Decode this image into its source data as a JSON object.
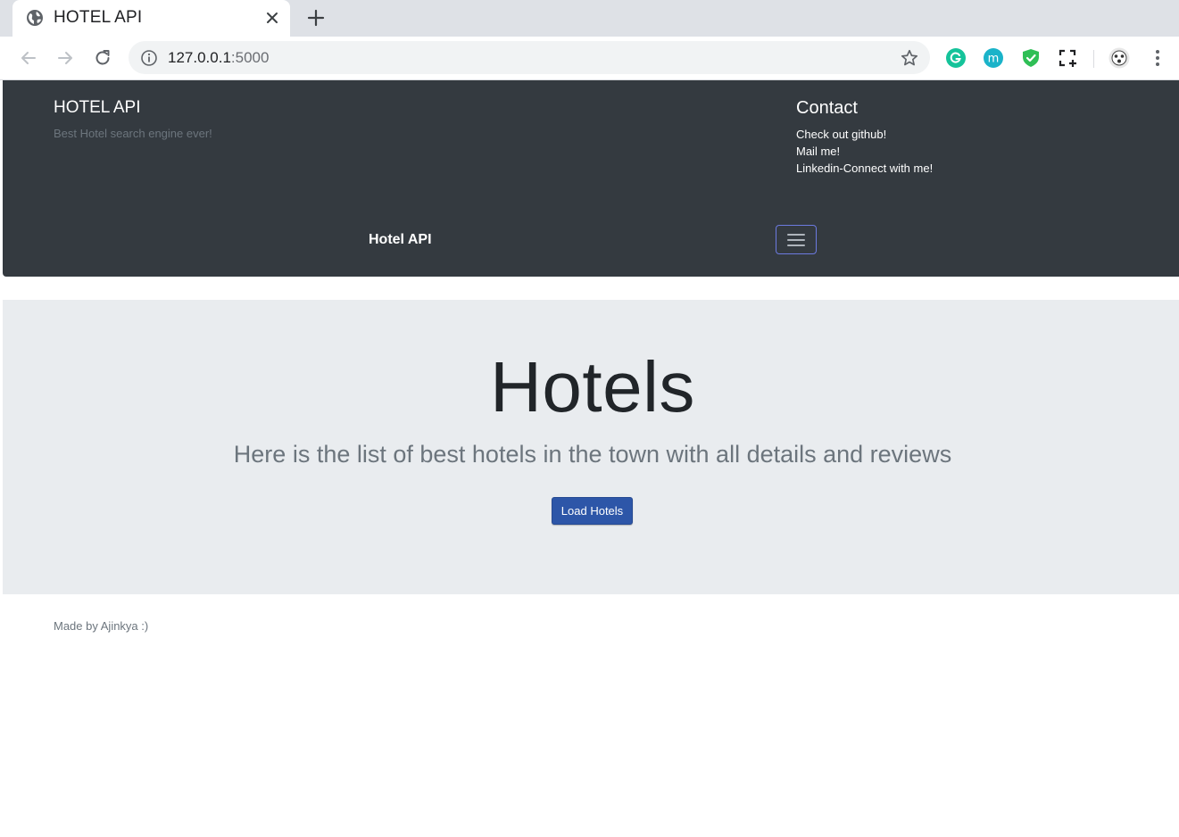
{
  "browser": {
    "tab_title": "HOTEL API",
    "url_host": "127.0.0.1",
    "url_port": ":5000",
    "icons": [
      "globe-icon",
      "close-icon",
      "plus-icon",
      "back-icon",
      "forward-icon",
      "reload-icon",
      "info-icon",
      "star-icon",
      "grammarly-icon",
      "extension-m-icon",
      "shield-check-icon",
      "screenshot-icon",
      "profile-avatar",
      "menu-icon"
    ]
  },
  "header": {
    "brand": "HOTEL API",
    "tagline": "Best Hotel search engine ever!",
    "contact_title": "Contact",
    "contact_links": [
      "Check out github!",
      "Mail me!",
      "Linkedin-Connect with me!"
    ],
    "navbar_brand": "Hotel API",
    "colors": {
      "background": "#343a40",
      "toggler_border": "#6c7ae0"
    }
  },
  "hero": {
    "title": "Hotels",
    "lead": "Here is the list of best hotels in the town with all details and reviews",
    "button_label": "Load Hotels",
    "colors": {
      "background": "#e9ecef",
      "button": "#2d56a8"
    }
  },
  "footer": {
    "text": "Made by Ajinkya :)"
  }
}
